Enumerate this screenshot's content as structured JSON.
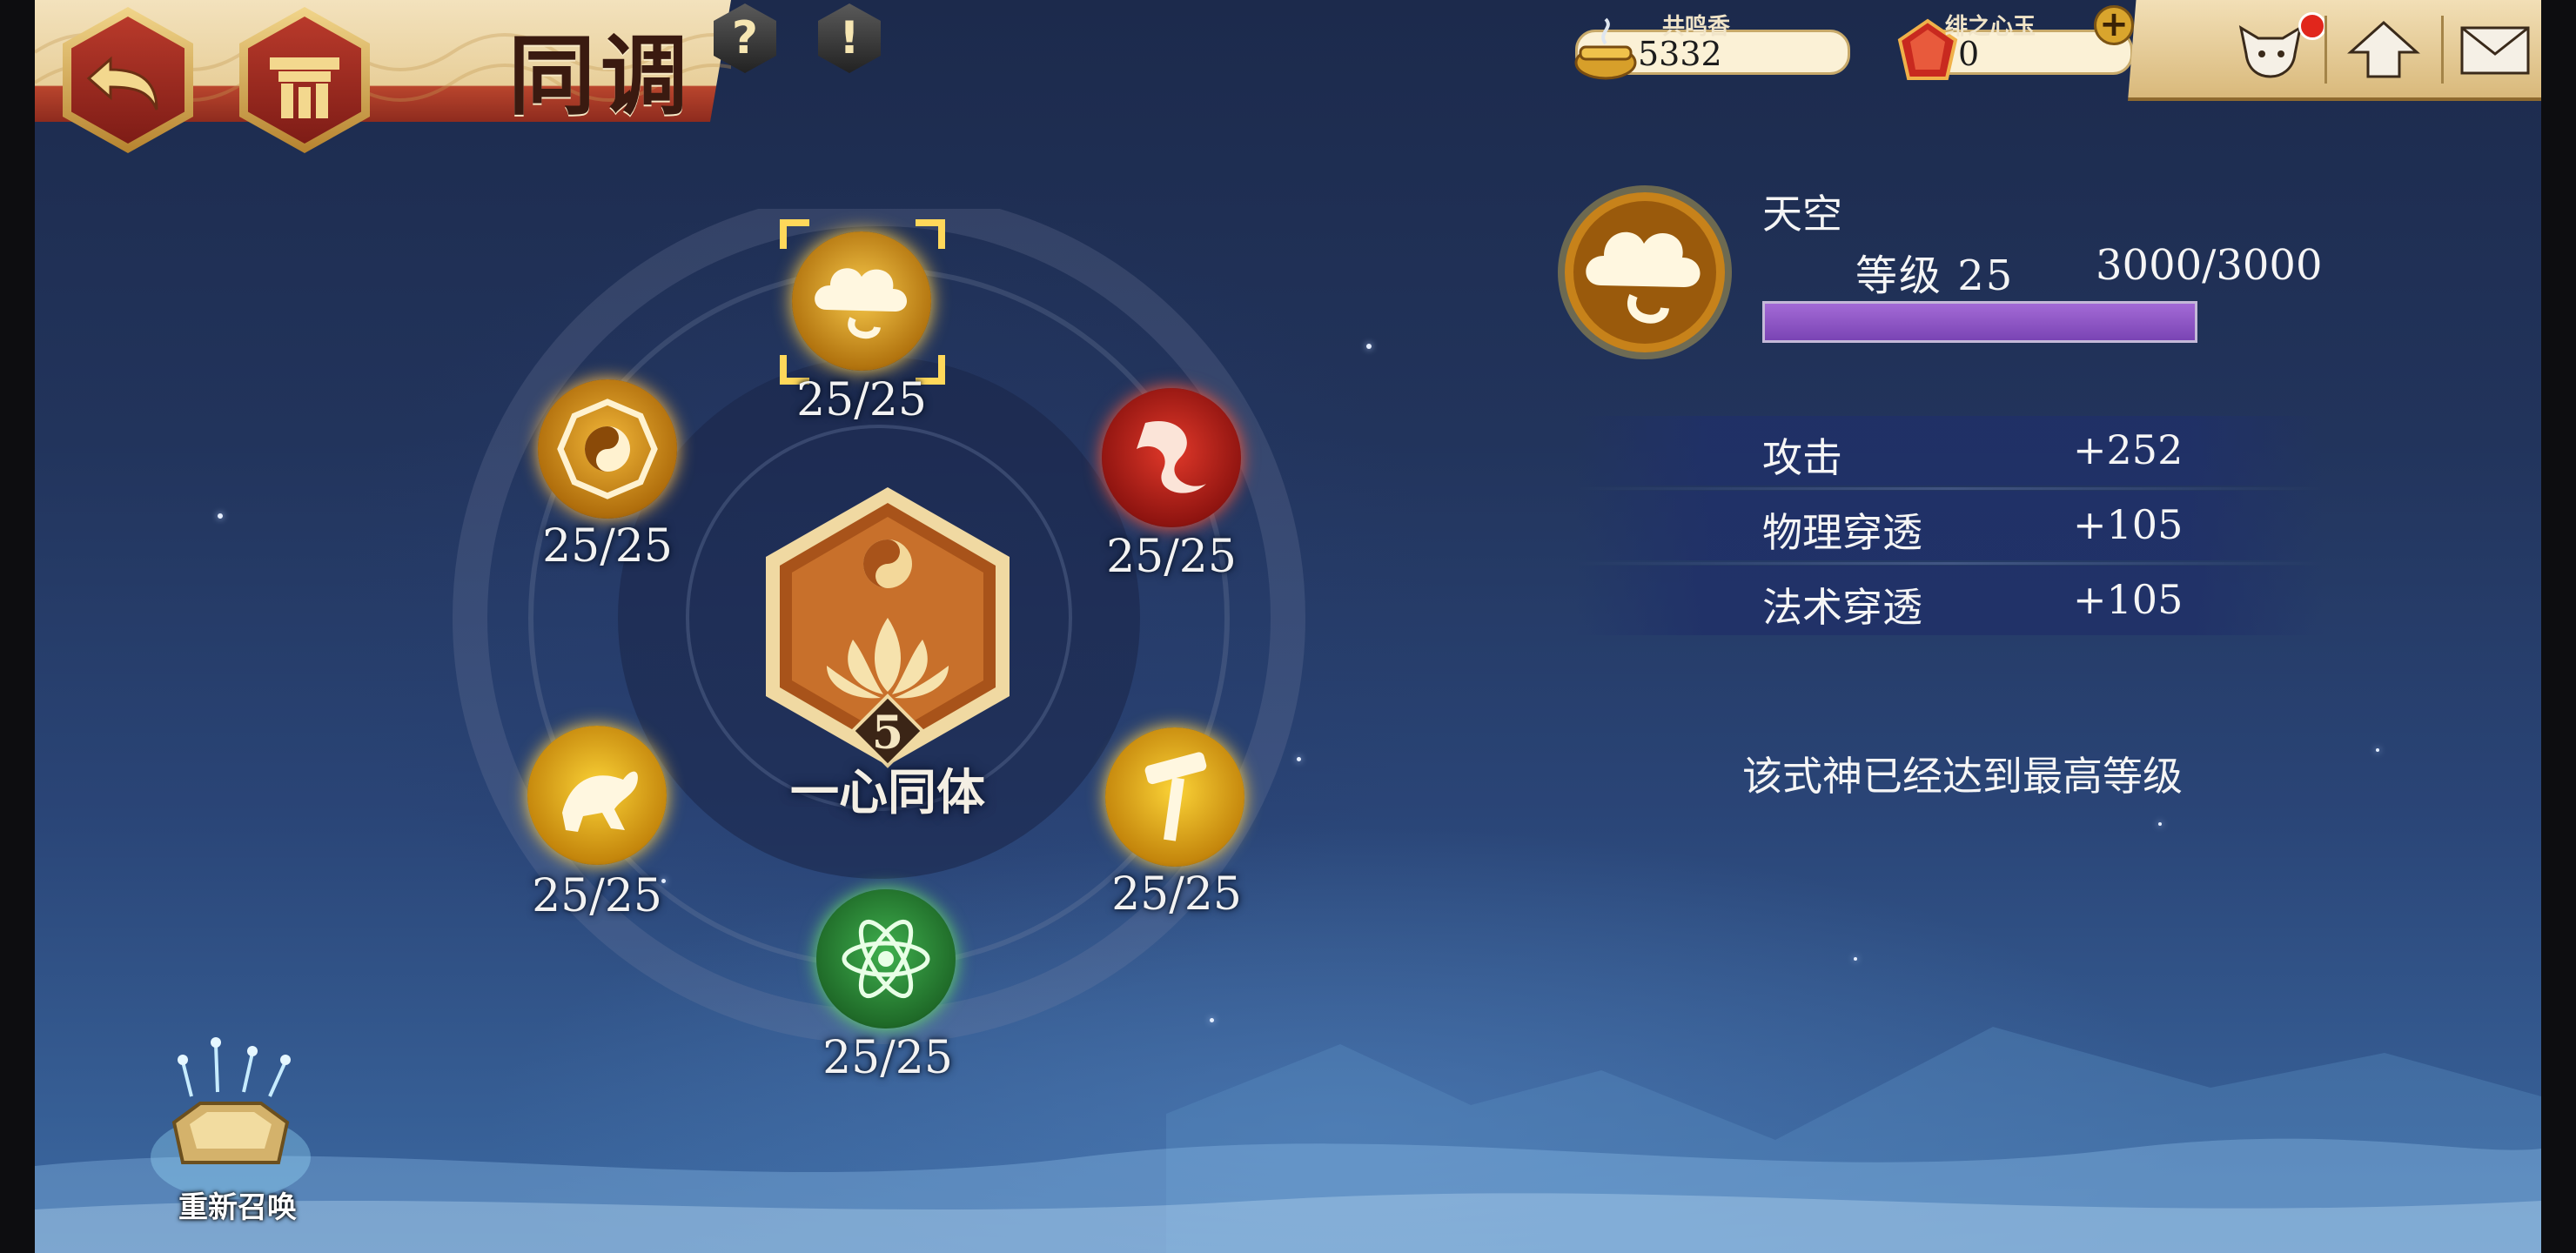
{
  "header": {
    "title": "同调",
    "back_button": "back-icon",
    "home_button": "shrine-icon",
    "help_button": "?",
    "info_button": "!"
  },
  "currency": [
    {
      "label": "共鸣香",
      "value": "5332",
      "icon": "incense-pot-icon"
    },
    {
      "label": "绯之心玉",
      "value": "0",
      "icon": "red-jade-icon",
      "add": "+"
    }
  ],
  "top_icons": [
    "fox-character-icon",
    "upgrade-arrow-icon",
    "mail-icon"
  ],
  "wheel": {
    "center": {
      "name": "一心同体",
      "level": "5",
      "icon": "lotus-yinyang-icon"
    },
    "nodes": [
      {
        "id": "sky",
        "progress": "25/25",
        "icon": "cloud-icon",
        "color": "gold",
        "selected": true
      },
      {
        "id": "dragon",
        "progress": "25/25",
        "icon": "dragon-icon",
        "color": "red"
      },
      {
        "id": "hammer",
        "progress": "25/25",
        "icon": "hammer-icon",
        "color": "gold"
      },
      {
        "id": "atom",
        "progress": "25/25",
        "icon": "atom-icon",
        "color": "green"
      },
      {
        "id": "beast",
        "progress": "25/25",
        "icon": "beast-icon",
        "color": "gold"
      },
      {
        "id": "bagua",
        "progress": "25/25",
        "icon": "bagua-icon",
        "color": "gold"
      }
    ]
  },
  "detail": {
    "name": "天空",
    "level_label": "等级 25",
    "exp": "3000/3000",
    "exp_fraction": 1.0,
    "stats": [
      {
        "name": "攻击",
        "value": "+252"
      },
      {
        "name": "物理穿透",
        "value": "+105"
      },
      {
        "name": "法术穿透",
        "value": "+105"
      }
    ],
    "max_message": "该式神已经达到最高等级"
  },
  "resummon": {
    "label": "重新召唤"
  },
  "colors": {
    "gold": "#e9b320",
    "red": "#c6261d",
    "green": "#2d8a3a",
    "exp_bar": "#8a52c4"
  }
}
